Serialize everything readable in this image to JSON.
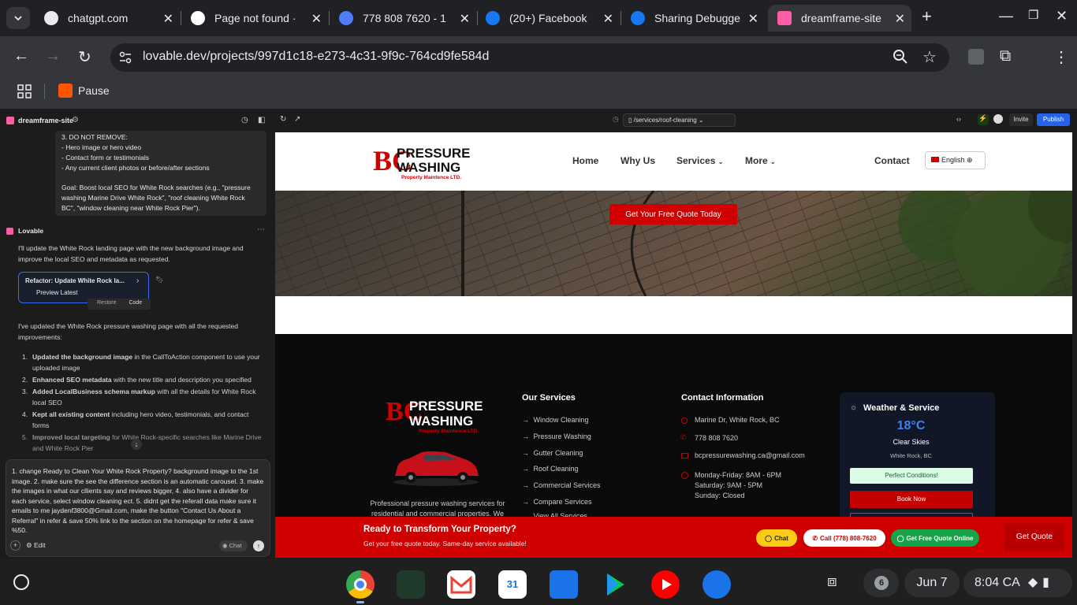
{
  "browser": {
    "tabs": [
      {
        "title": "chatgpt.com",
        "color": "#e8eaed"
      },
      {
        "title": "Page not found ·",
        "color": "#ffffff"
      },
      {
        "title": "778 808 7620 - 1",
        "color": "#4f7cf7"
      },
      {
        "title": "(20+) Facebook",
        "color": "#1877f2"
      },
      {
        "title": "Sharing Debugge",
        "color": "#1877f2"
      },
      {
        "title": "dreamframe-site",
        "color": "#ff5ca8"
      }
    ],
    "url": "lovable.dev/projects/997d1c18-e273-4c31-9f9c-764cd9fe584d",
    "bookmark": "Pause"
  },
  "editor": {
    "project_name": "dreamframe-site",
    "user_message_lines": [
      "3. DO NOT REMOVE:",
      "- Hero image or hero video",
      "- Contact form or testimonials",
      "- Any current client photos or before/after sections",
      "",
      "Goal: Boost local SEO for White Rock searches (e.g., \"pressure washing Marine Drive White Rock\", \"roof cleaning White Rock BC\", \"window cleaning near White Rock Pier\")."
    ],
    "assistant_name": "Lovable",
    "assistant_intro": "I'll update the White Rock landing page with the new background image and improve the local SEO and metadata as requested.",
    "card_title": "Refactor: Update White Rock la...",
    "card_sub": "Preview Latest",
    "card_restore": "Restore",
    "card_code": "Code",
    "summary": "I've updated the White Rock pressure washing page with all the requested improvements:",
    "items": [
      {
        "bold": "Updated the background image",
        "rest": " in the CallToAction component to use your uploaded image"
      },
      {
        "bold": "Enhanced SEO metadata",
        "rest": " with the new title and description you specified"
      },
      {
        "bold": "Added LocalBusiness schema markup",
        "rest": " with all the details for White Rock local SEO"
      },
      {
        "bold": "Kept all existing content",
        "rest": " including hero video, testimonials, and contact forms"
      },
      {
        "bold": "Improved local targeting",
        "rest": " for White Rock-specific searches like Marine Drive and White Rock Pier"
      }
    ],
    "input_text": "1. change Ready to Clean Your White Rock Property? background image to the 1st image. 2. make sure the see the difference section is an automatic carousel. 3. make the images in what our cllients say and reviews bigger, 4. also have a divider for each service, select window cleaning ect. 5. didnt get the referall data make sure it emails to me jaydenf3800@Gmail.com, make the button \"Contact Us About a Referral\" in refer & save 50% link to the section on the homepage  for refer & save %50.",
    "edit_label": "Edit",
    "chat_label": "Chat"
  },
  "preview": {
    "route": "/services/roof-cleaning",
    "invite": "Invite",
    "publish": "Publish"
  },
  "site": {
    "logo_line1": "PRESSURE",
    "logo_line2": "WASHING",
    "logo_sub": "Property Maintence LTD.",
    "nav": [
      "Home",
      "Why Us",
      "Services",
      "More",
      "Contact"
    ],
    "language": "English",
    "hero_cta": "Get Your Free Quote Today",
    "footer_desc_1": "Professional pressure washing services for",
    "footer_desc_2": "residential and commercial properties. We",
    "services_title": "Our Services",
    "services": [
      "Window Cleaning",
      "Pressure Washing",
      "Gutter Cleaning",
      "Roof Cleaning",
      "Commercial Services",
      "Compare Services",
      "View All Services"
    ],
    "contact_title": "Contact Information",
    "address": "Marine Dr, White Rock, BC",
    "phone": "778 808 7620",
    "email": "bcpressurewashing.ca@gmail.com",
    "hours_1": "Monday-Friday: 8AM - 6PM",
    "hours_2": "Saturday: 9AM - 5PM",
    "hours_3": "Sunday: Closed",
    "weather_title": "Weather & Service",
    "temp": "18°C",
    "condition": "Clear Skies",
    "location": "White Rock, BC",
    "perfect": "Perfect Conditions!",
    "book": "Book Now",
    "cta_title": "Ready to Transform Your Property?",
    "cta_sub": "Get your free quote today. Same-day service available!",
    "cta_chat": "Chat",
    "cta_call": "Call (778) 808-7620",
    "cta_quote_online": "Get Free Quote Online",
    "cta_get_quote": "Get Quote"
  },
  "shelf": {
    "notif_count": "6",
    "date": "Jun 7",
    "time": "8:04",
    "region": "CA"
  }
}
